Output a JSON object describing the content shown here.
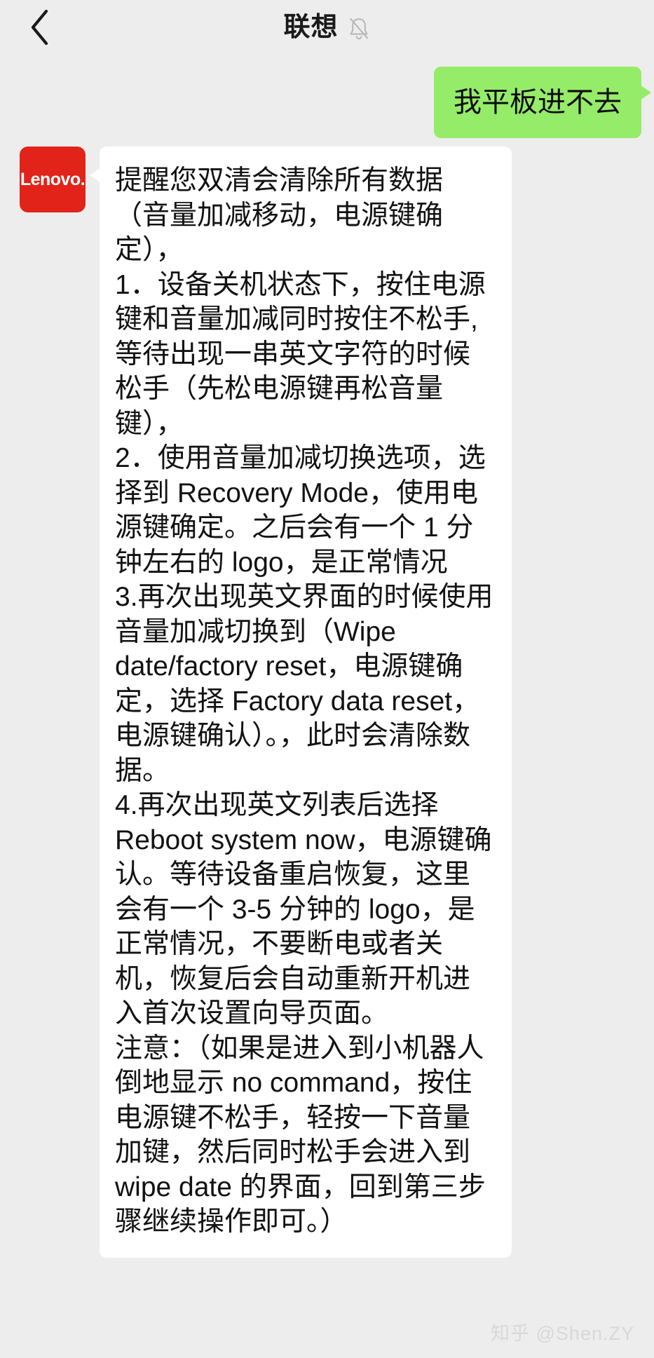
{
  "header": {
    "back_icon": "chevron-left-icon",
    "title": "联想",
    "mute_icon": "bell-muted-icon"
  },
  "conversation": {
    "messages": [
      {
        "side": "outgoing",
        "sender": "user",
        "text": "我平板进不去"
      },
      {
        "side": "incoming",
        "sender": "Lenovo",
        "avatar_text": "Lenovo.",
        "avatar_color": "#e2231a",
        "text": "提醒您双清会清除所有数据（音量加减移动，电源键确定），\n1．设备关机状态下，按住电源键和音量加减同时按住不松手,等待出现一串英文字符的时候松手（先松电源键再松音量键），\n2．使用音量加减切换选项，选择到 Recovery Mode，使用电源键确定。之后会有一个 1 分钟左右的 logo，是正常情况\n3.再次出现英文界面的时候使用音量加减切换到（Wipe date/factory reset，电源键确定，选择 Factory data reset，电源键确认）。，此时会清除数据。\n4.再次出现英文列表后选择 Reboot system now，电源键确认。等待设备重启恢复，这里会有一个 3-5 分钟的 logo，是正常情况，不要断电或者关机，恢复后会自动重新开机进入首次设置向导页面。\n注意：（如果是进入到小机器人倒地显示 no command，按住电源键不松手，轻按一下音量加键，然后同时松手会进入到 wipe date 的界面，回到第三步骤继续操作即可。）"
      }
    ]
  },
  "watermark": {
    "text": "知乎 @Shen.ZY"
  },
  "colors": {
    "page_background": "#ededed",
    "outgoing_bubble": "#95ec69",
    "incoming_bubble": "#ffffff",
    "brand_red": "#e2231a",
    "title_text": "#1a1a1a"
  }
}
